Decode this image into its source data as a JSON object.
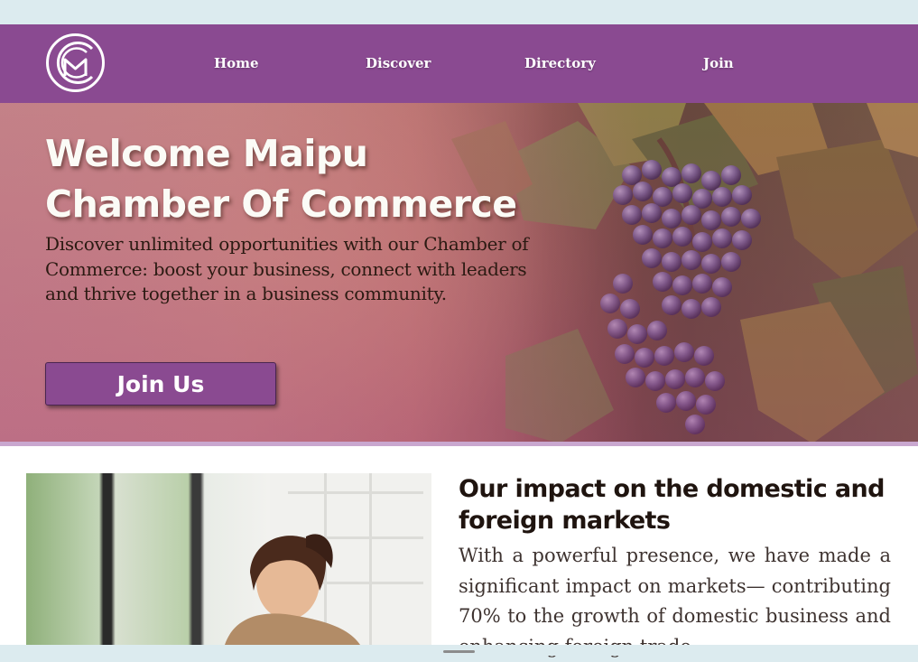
{
  "nav": {
    "items": [
      "Home",
      "Discover",
      "Directory",
      "Join"
    ]
  },
  "hero": {
    "title_line1": "Welcome Maipu",
    "title_line2": "Chamber Of Commerce",
    "description": "Discover unlimited opportunities with our Chamber of Commerce: boost your business, connect with leaders and thrive together in a business community.",
    "cta_label": "Join Us"
  },
  "impact": {
    "title": "Our impact on the domestic and foreign markets",
    "text": "With a powerful presence, we have made a significant impact on markets— contributing 70% to the growth of domestic business and enhancing foreign trade."
  },
  "colors": {
    "brand": "#8a4a91",
    "page_bg": "#dcebef",
    "title_text": "#1f140f"
  },
  "icons": {
    "logo": "chamber-logo-icon"
  }
}
